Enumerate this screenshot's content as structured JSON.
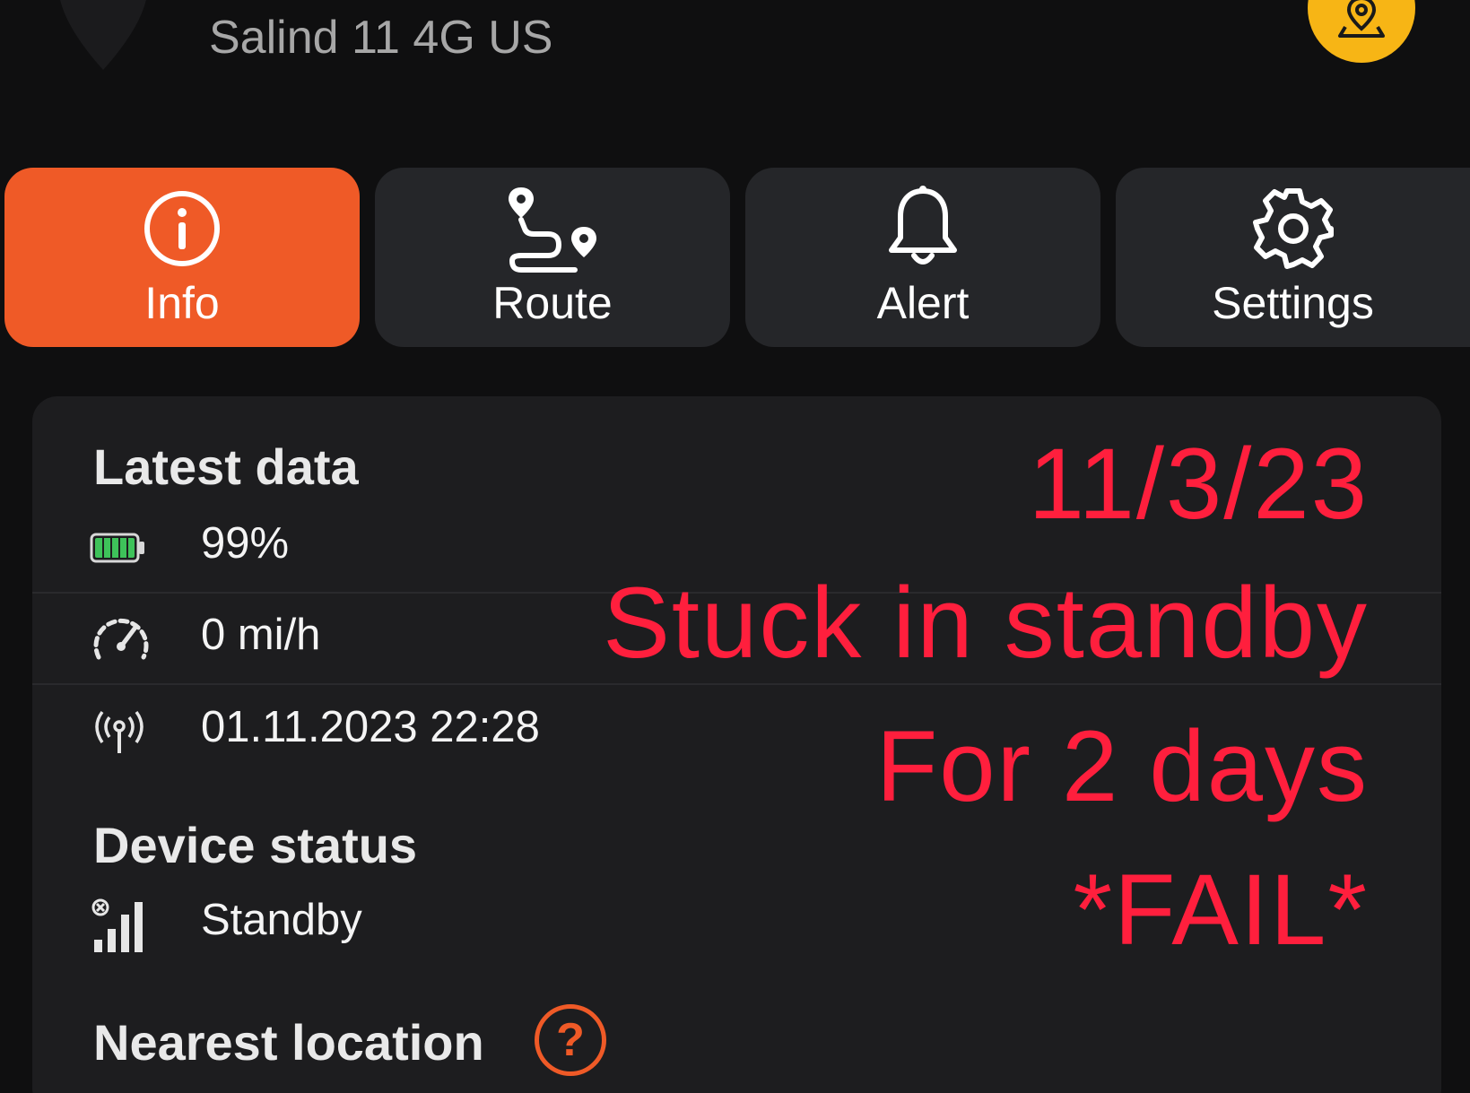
{
  "header": {
    "device_name": "Salind 11 4G US",
    "map_icon": "map-pin-icon",
    "accent_color": "#f7b515"
  },
  "tabs": [
    {
      "label": "Info",
      "icon": "info-icon",
      "active": true
    },
    {
      "label": "Route",
      "icon": "route-icon",
      "active": false
    },
    {
      "label": "Alert",
      "icon": "bell-icon",
      "active": false
    },
    {
      "label": "Settings",
      "icon": "gear-icon",
      "active": false
    }
  ],
  "latest_data": {
    "title": "Latest data",
    "battery": {
      "icon": "battery-icon",
      "value": "99%",
      "level": 0.99
    },
    "speed": {
      "icon": "speedometer-icon",
      "value": "0 mi/h"
    },
    "signal_time": {
      "icon": "antenna-icon",
      "value": "01.11.2023 22:28"
    }
  },
  "device_status": {
    "title": "Device status",
    "icon": "no-signal-icon",
    "value": "Standby"
  },
  "nearest_location": {
    "title": "Nearest location",
    "help_icon": "?"
  },
  "annotation": {
    "line1": "11/3/23",
    "line2": "Stuck in standby",
    "line3": "For 2 days",
    "line4": "*FAIL*",
    "color": "#ff1f3d"
  },
  "colors": {
    "active_tab": "#ef5a27",
    "inactive_tab": "#252629",
    "background": "#0f0f10",
    "panel": "#1d1d1f"
  }
}
